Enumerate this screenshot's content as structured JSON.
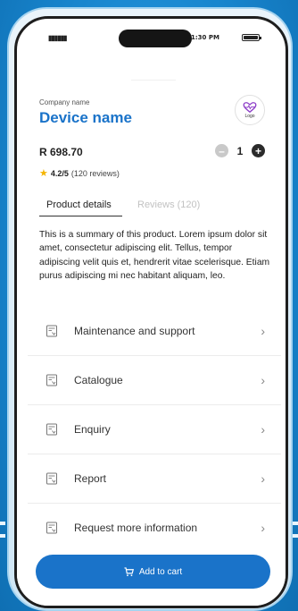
{
  "status_bar": {
    "time": "1:30 PM",
    "signal": "▮▮▮▮▮▮"
  },
  "product": {
    "company": "Company name",
    "name": "Device name",
    "logo_label": "Logo",
    "price": "R 698.70",
    "quantity": "1",
    "rating_value": "4.2/5",
    "rating_reviews": "(120 reviews)"
  },
  "tabs": [
    {
      "label": "Product details",
      "active": true
    },
    {
      "label": "Reviews (120)",
      "active": false
    }
  ],
  "summary": "This is a summary of this product. Lorem ipsum dolor sit amet, consectetur adipiscing elit. Tellus, tempor adipiscing velit quis et, hendrerit vitae scelerisque. Etiam purus adipiscing mi nec habitant aliquam, leo.",
  "menu": [
    {
      "label": "Maintenance and support",
      "icon": "document-icon"
    },
    {
      "label": "Catalogue",
      "icon": "document-icon"
    },
    {
      "label": "Enquiry",
      "icon": "document-icon"
    },
    {
      "label": "Report",
      "icon": "document-icon"
    },
    {
      "label": "Request more information",
      "icon": "document-icon"
    }
  ],
  "cart": {
    "label": "Add to cart"
  },
  "colors": {
    "brand": "#1a73c9",
    "background": "#1a8fd8",
    "star": "#f4b400"
  }
}
